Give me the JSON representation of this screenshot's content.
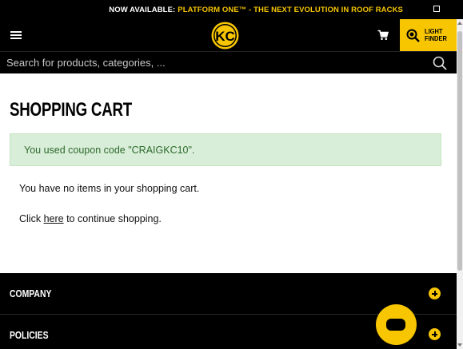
{
  "promo": {
    "prefix": "NOW AVAILABLE:",
    "link_text": "PLATFORM ONE™ - THE NEXT EVOLUTION IN ROOF RACKS"
  },
  "header": {
    "logo_text": "KC",
    "light_finder_line1": "LIGHT",
    "light_finder_line2": "FINDER"
  },
  "search": {
    "placeholder": "Search for products, categories, ..."
  },
  "main": {
    "title": "SHOPPING CART",
    "alert": "You used coupon code \"CRAIGKC10\".",
    "empty_message": "You have no items in your shopping cart.",
    "continue_prefix": "Click ",
    "continue_link": "here",
    "continue_suffix": " to continue shopping."
  },
  "footer": {
    "sections": [
      {
        "label": "COMPANY"
      },
      {
        "label": "POLICIES"
      }
    ]
  },
  "colors": {
    "brand_yellow": "#f7c600",
    "background_dark": "#000000",
    "alert_bg": "#d9eed8",
    "alert_text": "#2d6a2e"
  }
}
